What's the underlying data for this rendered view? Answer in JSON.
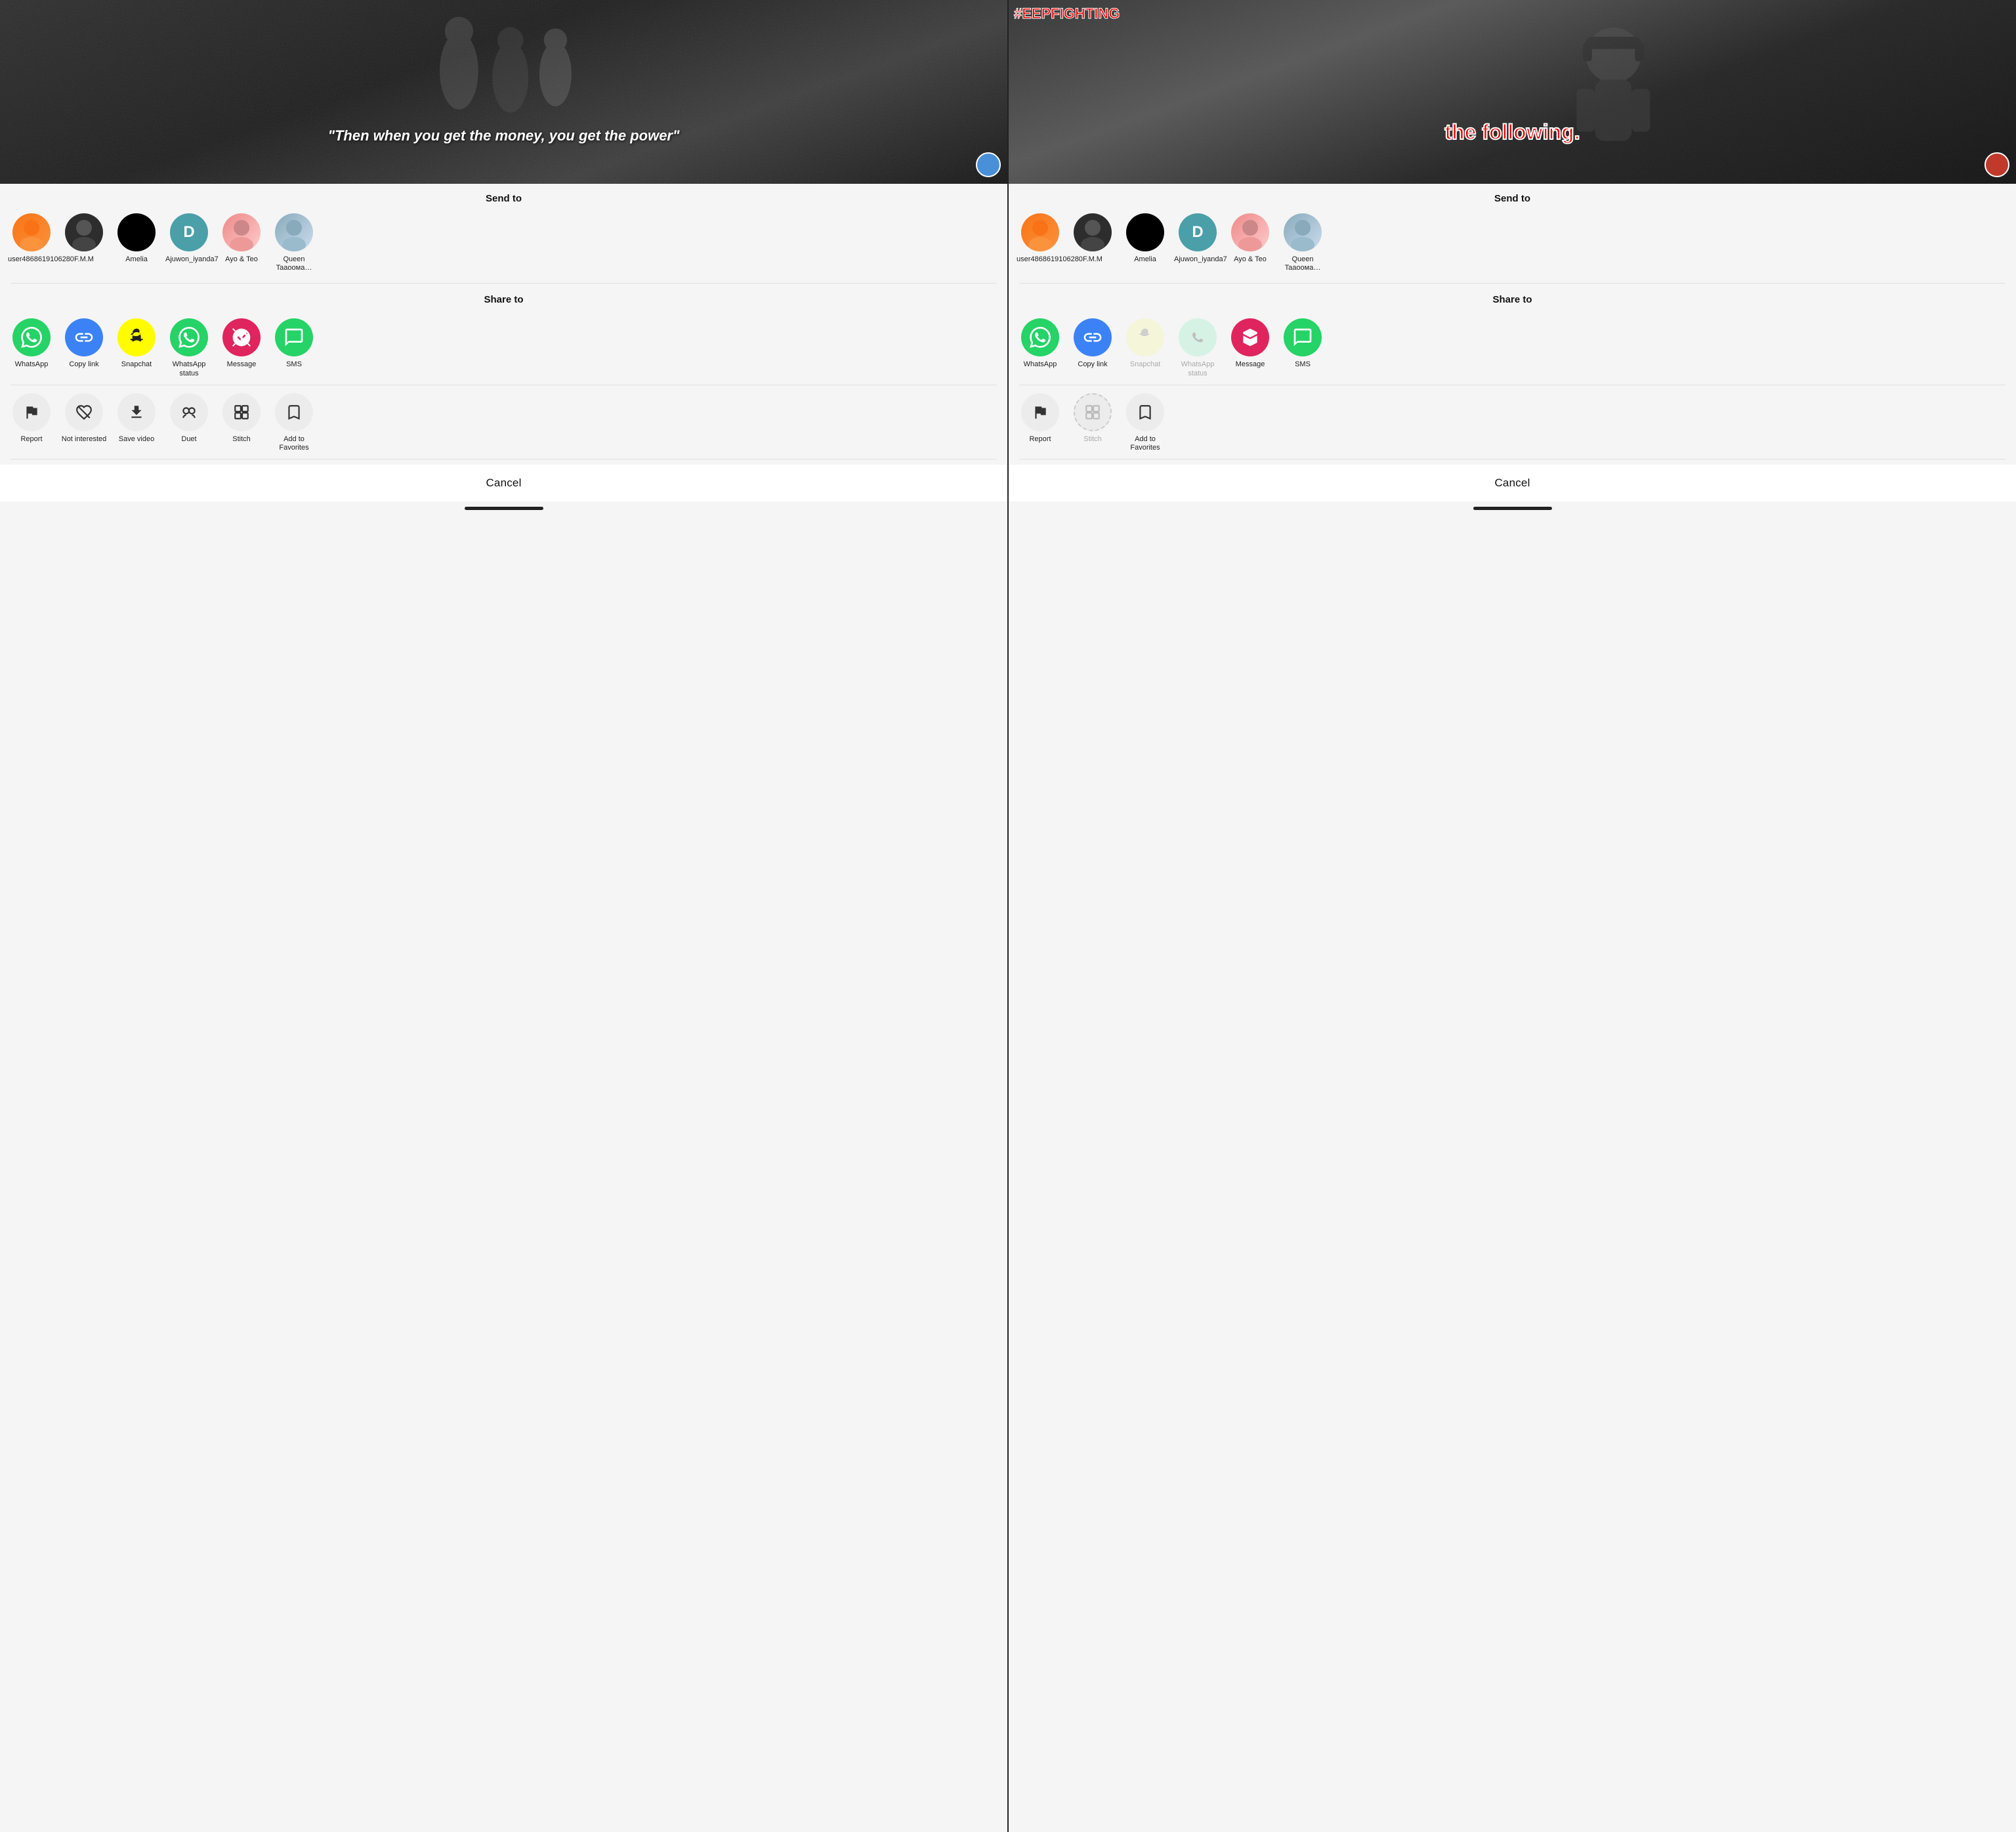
{
  "panels": [
    {
      "id": "panel-left",
      "video": {
        "quote": "\"Then when you get the money, you get the power\"",
        "hashtag": null
      },
      "sheet": {
        "send_to_label": "Send to",
        "contacts": [
          {
            "id": "user486",
            "name": "user4868619106280",
            "avatar_type": "photo",
            "avatar_color": "orange"
          },
          {
            "id": "fmm",
            "name": "F.M.M",
            "avatar_type": "photo",
            "avatar_color": "dark"
          },
          {
            "id": "amelia",
            "name": "Amelia",
            "avatar_type": "initial",
            "initial": "",
            "avatar_color": "black"
          },
          {
            "id": "ajuwon",
            "name": "Ajuwon_iyanda7",
            "avatar_type": "initial",
            "initial": "D",
            "avatar_color": "teal"
          },
          {
            "id": "ayo",
            "name": "Ayo & Teo",
            "avatar_type": "photo",
            "avatar_color": "photo1"
          },
          {
            "id": "queen",
            "name": "Queen Taaooма…",
            "avatar_type": "photo",
            "avatar_color": "photo2"
          }
        ],
        "share_to_label": "Share to",
        "share_items": [
          {
            "id": "whatsapp",
            "label": "WhatsApp",
            "icon": "whatsapp",
            "color": "whatsapp",
            "muted": false
          },
          {
            "id": "copylink",
            "label": "Copy link",
            "icon": "link",
            "color": "copylink",
            "muted": false
          },
          {
            "id": "snapchat",
            "label": "Snapchat",
            "icon": "snapchat",
            "color": "snapchat",
            "muted": false
          },
          {
            "id": "whatsapp-status",
            "label": "WhatsApp status",
            "icon": "whatsapp",
            "color": "whatsapp-status",
            "muted": false
          },
          {
            "id": "message",
            "label": "Message",
            "icon": "message",
            "color": "message",
            "muted": false
          },
          {
            "id": "sms",
            "label": "SMS",
            "icon": "sms",
            "color": "sms",
            "muted": false
          }
        ],
        "action_items": [
          {
            "id": "report",
            "label": "Report",
            "icon": "flag",
            "muted": false
          },
          {
            "id": "not-interested",
            "label": "Not interested",
            "icon": "heart-broken",
            "muted": false
          },
          {
            "id": "save-video",
            "label": "Save video",
            "icon": "download",
            "muted": false
          },
          {
            "id": "duet",
            "label": "Duet",
            "icon": "duet",
            "muted": false
          },
          {
            "id": "stitch",
            "label": "Stitch",
            "icon": "stitch",
            "muted": false
          },
          {
            "id": "add-favorites",
            "label": "Add to Favorites",
            "icon": "bookmark",
            "muted": false
          }
        ],
        "cancel_label": "Cancel"
      }
    },
    {
      "id": "panel-right",
      "video": {
        "quote": "the following.",
        "hashtag": "#EEPFIGHTING"
      },
      "sheet": {
        "send_to_label": "Send to",
        "contacts": [
          {
            "id": "user486",
            "name": "user4868619106280",
            "avatar_type": "photo",
            "avatar_color": "orange"
          },
          {
            "id": "fmm",
            "name": "F.M.M",
            "avatar_type": "photo",
            "avatar_color": "dark"
          },
          {
            "id": "amelia",
            "name": "Amelia",
            "avatar_type": "initial",
            "initial": "",
            "avatar_color": "black"
          },
          {
            "id": "ajuwon",
            "name": "Ajuwon_iyanda7",
            "avatar_type": "initial",
            "initial": "D",
            "avatar_color": "teal"
          },
          {
            "id": "ayo",
            "name": "Ayo & Teo",
            "avatar_type": "photo",
            "avatar_color": "photo1"
          },
          {
            "id": "queen",
            "name": "Queen Taaooма…",
            "avatar_type": "photo",
            "avatar_color": "photo2"
          }
        ],
        "share_to_label": "Share to",
        "share_items": [
          {
            "id": "whatsapp",
            "label": "WhatsApp",
            "icon": "whatsapp",
            "color": "whatsapp",
            "muted": false
          },
          {
            "id": "copylink",
            "label": "Copy link",
            "icon": "link",
            "color": "copylink",
            "muted": false
          },
          {
            "id": "snapchat",
            "label": "Snapchat",
            "icon": "snapchat",
            "color": "snapchat",
            "muted": true
          },
          {
            "id": "whatsapp-status",
            "label": "WhatsApp status",
            "icon": "whatsapp",
            "color": "whatsapp-status",
            "muted": true
          },
          {
            "id": "message",
            "label": "Message",
            "icon": "message",
            "color": "message",
            "muted": false
          },
          {
            "id": "sms",
            "label": "SMS",
            "icon": "sms",
            "color": "sms",
            "muted": false
          }
        ],
        "action_items": [
          {
            "id": "report",
            "label": "Report",
            "icon": "flag",
            "muted": false
          },
          {
            "id": "stitch",
            "label": "Stitch",
            "icon": "stitch",
            "muted": true
          },
          {
            "id": "add-favorites",
            "label": "Add to Favorites",
            "icon": "bookmark",
            "muted": false
          }
        ],
        "cancel_label": "Cancel"
      }
    }
  ]
}
